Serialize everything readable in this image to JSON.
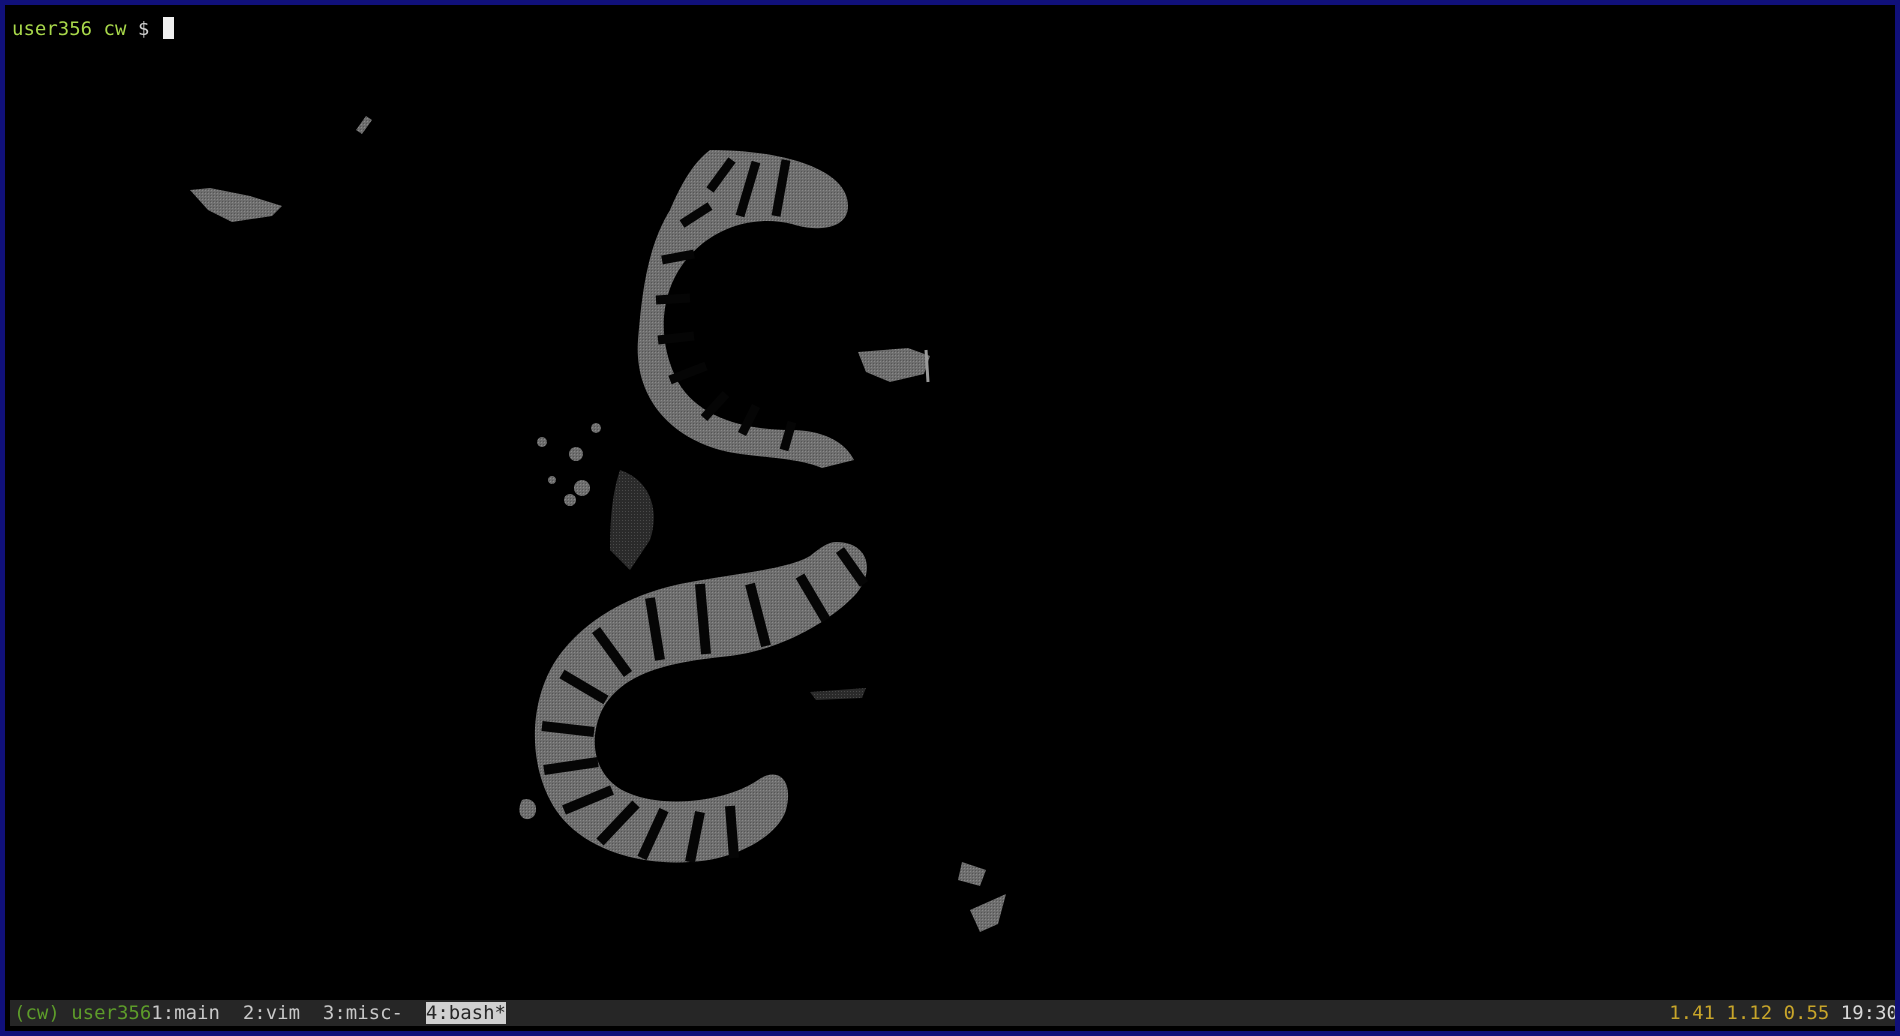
{
  "terminal": {
    "prompt": {
      "user": "user356",
      "dir": "cw",
      "symbol": "$"
    },
    "background": "#000000",
    "frame_color": "#10107a"
  },
  "wallpaper": {
    "icon": "serpent-wallpaper-icon"
  },
  "statusbar": {
    "session": "(cw)",
    "host": "user356",
    "windows": [
      {
        "label": "1:main"
      },
      {
        "label": "2:vim"
      },
      {
        "label": "3:misc-"
      },
      {
        "label": "4:bash*"
      }
    ],
    "active_window": 3,
    "load_avg": "1.41 1.12 0.55",
    "time": "19:30",
    "colors": {
      "bar_bg": "#262626",
      "session": "#5d9c2a",
      "load": "#c8a52a",
      "active_bg": "#d0d0d0"
    }
  }
}
